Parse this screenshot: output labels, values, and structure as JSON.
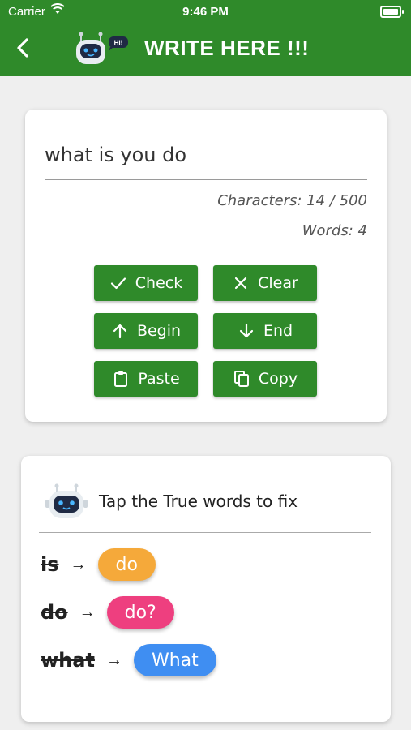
{
  "status_bar": {
    "carrier": "Carrier",
    "time": "9:46 PM"
  },
  "header": {
    "title": "WRITE HERE !!!",
    "robot_badge": "HI!"
  },
  "editor": {
    "text": "what is you do",
    "characters": "Characters: 14 / 500",
    "words": "Words: 4"
  },
  "buttons": {
    "check": "Check",
    "clear": "Clear",
    "begin": "Begin",
    "end": "End",
    "paste": "Paste",
    "copy": "Copy"
  },
  "suggestions": {
    "title": "Tap the True words to fix",
    "items": [
      {
        "wrong": "is",
        "fix": "do",
        "color": "#f5a93a"
      },
      {
        "wrong": "do",
        "fix": "do?",
        "color": "#ee3f7f"
      },
      {
        "wrong": "what",
        "fix": "What",
        "color": "#3f8ef2"
      }
    ]
  },
  "colors": {
    "brand_green": "#2f8a2a",
    "background": "#efefef"
  }
}
